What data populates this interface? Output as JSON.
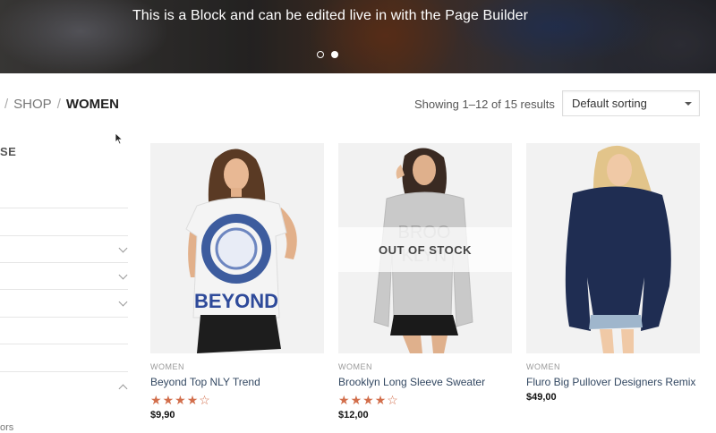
{
  "hero": {
    "text": "This is a Block and can be edited live in with the Page Builder",
    "slides": 2,
    "active_slide": 2
  },
  "breadcrumb": {
    "items": [
      "SHOP",
      "WOMEN"
    ],
    "separator": "/"
  },
  "results": {
    "count_text": "Showing 1–12 of 15 results"
  },
  "sorting": {
    "selected": "Default sorting"
  },
  "sidebar": {
    "title_fragment": "SE",
    "bottom_fragment": "ors"
  },
  "products": [
    {
      "category": "WOMEN",
      "title": "Beyond Top NLY Trend",
      "rating": 4,
      "max_rating": 5,
      "price": "$9,90",
      "out_of_stock": false
    },
    {
      "category": "WOMEN",
      "title": "Brooklyn Long Sleeve Sweater",
      "rating": 4,
      "max_rating": 5,
      "price": "$12,00",
      "out_of_stock": true,
      "badge": "OUT OF STOCK"
    },
    {
      "category": "WOMEN",
      "title": "Fluro Big Pullover Designers Remix",
      "price": "$49,00",
      "out_of_stock": false
    }
  ],
  "colors": {
    "star": "#d26e4b",
    "title_link": "#334862",
    "breadcrumb_current": "#222222"
  }
}
